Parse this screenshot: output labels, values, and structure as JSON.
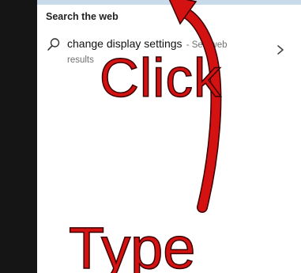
{
  "search_panel": {
    "section_heading": "Search the web",
    "results": [
      {
        "query": "change display settings",
        "suffix_line1": " - See web",
        "suffix_line2": "results",
        "icon": "search-icon",
        "trailing_icon": "chevron-right-icon"
      }
    ]
  },
  "annotations": {
    "click_text": "Click",
    "type_text": "Type",
    "arrow_icon": "curved-arrow-icon",
    "color": "#d41212"
  },
  "colors": {
    "top_bar": "#c9dbeb",
    "left_strip": "#151515"
  }
}
